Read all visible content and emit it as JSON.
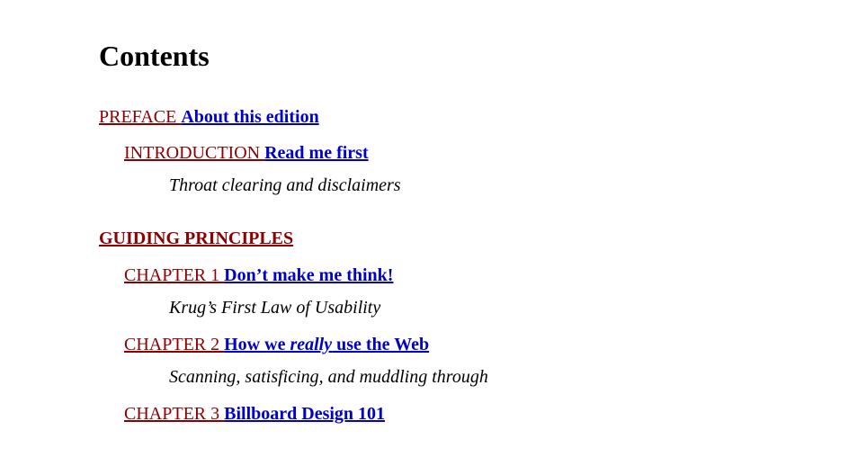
{
  "heading": "Contents",
  "preface": {
    "label": "PREFACE ",
    "title": "About this edition"
  },
  "introduction": {
    "label": "INTRODUCTION ",
    "title": "Read me first",
    "subtitle": "Throat clearing and disclaimers"
  },
  "section": {
    "label": "GUIDING PRINCIPLES"
  },
  "chapters": [
    {
      "label": "CHAPTER 1 ",
      "title": "Don’t make me think!",
      "subtitle": "Krug’s First Law of Usability"
    },
    {
      "label": "CHAPTER 2 ",
      "title_pre": "How we ",
      "title_em": "really",
      "title_post": " use the Web",
      "subtitle": "Scanning, satisficing, and muddling through"
    },
    {
      "label": "CHAPTER 3 ",
      "title": "Billboard Design 101"
    }
  ]
}
